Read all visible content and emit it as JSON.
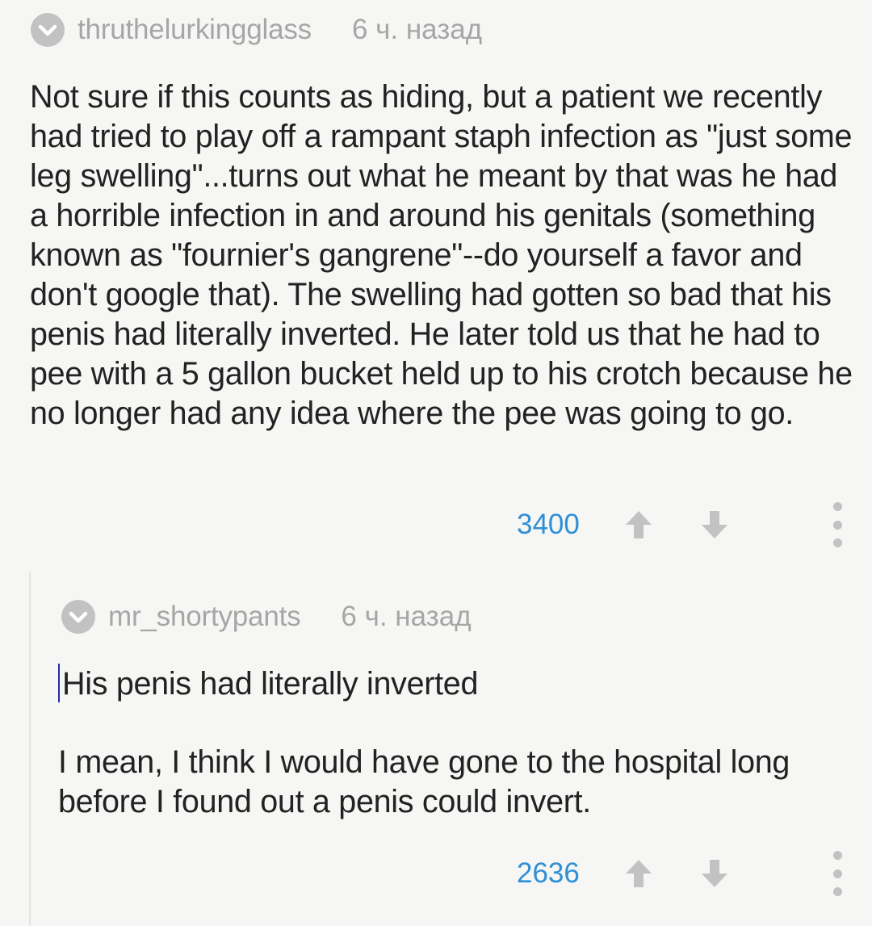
{
  "comments": [
    {
      "username": "thruthelurkingglass",
      "timestamp": "6 ч. назад",
      "text": "Not sure if this counts as hiding, but a patient we recently had tried to play off a rampant staph infection as \"just some leg swelling\"...turns out what he meant by that was he had a horrible infection in and around his genitals (something known as \"fournier's gangrene\"--do yourself a favor and don't google that). The swelling had gotten so bad that his penis had literally inverted. He later told us that he had to pee with a 5 gallon bucket held up to his crotch because he no longer had any idea where the pee was going to go.",
      "score": "3400"
    },
    {
      "username": "mr_shortypants",
      "timestamp": "6 ч. назад",
      "quote": "His penis had literally inverted",
      "text": "I mean, I think I would have gone to the hospital long before I found out a penis could invert.",
      "score": "2636"
    }
  ],
  "colors": {
    "background": "#f6f6f4",
    "text": "#222222",
    "meta": "#a6a6a6",
    "score": "#2f8fd6",
    "icon": "#c2c2c2",
    "cursor": "#2a2aa8"
  },
  "icons": {
    "badge": "check-icon",
    "upvote": "arrow-up-icon",
    "downvote": "arrow-down-icon",
    "more": "more-vertical-icon"
  }
}
